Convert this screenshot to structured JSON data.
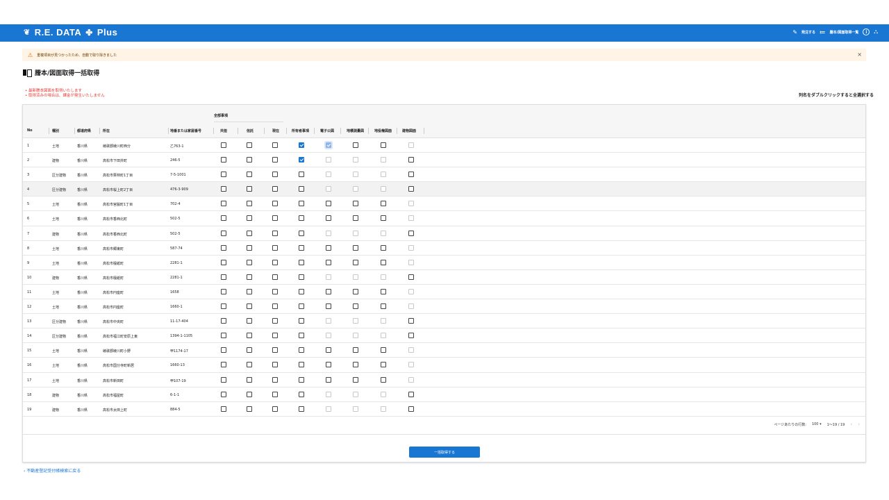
{
  "header": {
    "brand": "R.E. DATA",
    "brand_suffix": "Plus",
    "actions": {
      "order_label": "発注する",
      "list_label": "謄本/図面取得一覧"
    },
    "icons": [
      "leaf-logo-icon",
      "handshake-logo-icon",
      "pencil-icon",
      "list-icon",
      "info-icon",
      "account-tree-icon"
    ],
    "accent_color": "#1976d2"
  },
  "alert": {
    "message": "重複項目が見つかったため、自動で取り除きました",
    "close": "×"
  },
  "page": {
    "title": "謄本/図面取得一括取得",
    "notes": [
      "最新謄本図面を取得いたします",
      "取得済みの場合は、課金が発生いたしません"
    ],
    "hint": "列名をダブルクリックすると全選択する"
  },
  "table": {
    "group_header": "全部事項",
    "columns": [
      "No",
      "種別",
      "都道府県",
      "所在",
      "地番または家屋番号",
      "共担",
      "信託",
      "現在",
      "所有者事項",
      "電子公図",
      "地積測量図",
      "地役権図面",
      "建物図面"
    ],
    "rows": [
      {
        "no": "1",
        "type": "土地",
        "pref": "香川県",
        "loc": "綾歌郡綾川町西分",
        "num": "乙763-1",
        "checks": [
          "off",
          "off",
          "off",
          "on",
          "ondis",
          "off",
          "off",
          "dis"
        ]
      },
      {
        "no": "2",
        "type": "建物",
        "pref": "香川県",
        "loc": "高松市下田井町",
        "num": "246-5",
        "checks": [
          "off",
          "off",
          "off",
          "on",
          "dis",
          "dis",
          "dis",
          "off"
        ]
      },
      {
        "no": "3",
        "type": "区分建物",
        "pref": "香川県",
        "loc": "高松市栗林町1丁目",
        "num": "7-5-1001",
        "checks": [
          "off",
          "off",
          "off",
          "off",
          "dis",
          "dis",
          "dis",
          "off"
        ]
      },
      {
        "no": "4",
        "type": "区分建物",
        "pref": "香川県",
        "loc": "高松市桜上町2丁目",
        "num": "476-3-909",
        "checks": [
          "off",
          "off",
          "off",
          "off",
          "dis",
          "dis",
          "dis",
          "off"
        ]
      },
      {
        "no": "5",
        "type": "土地",
        "pref": "香川県",
        "loc": "高松市宮脇町1丁目",
        "num": "702-4",
        "checks": [
          "off",
          "off",
          "off",
          "off",
          "off",
          "off",
          "off",
          "dis"
        ]
      },
      {
        "no": "6",
        "type": "土地",
        "pref": "香川県",
        "loc": "高松市香西北町",
        "num": "502-5",
        "checks": [
          "off",
          "off",
          "off",
          "off",
          "off",
          "off",
          "off",
          "dis"
        ]
      },
      {
        "no": "7",
        "type": "建物",
        "pref": "香川県",
        "loc": "高松市香西北町",
        "num": "502-5",
        "checks": [
          "off",
          "off",
          "off",
          "off",
          "dis",
          "dis",
          "dis",
          "off"
        ]
      },
      {
        "no": "8",
        "type": "土地",
        "pref": "香川県",
        "loc": "高松市郷東町",
        "num": "587-74",
        "checks": [
          "off",
          "off",
          "off",
          "off",
          "off",
          "off",
          "off",
          "dis"
        ]
      },
      {
        "no": "9",
        "type": "土地",
        "pref": "香川県",
        "loc": "高松市檀紙町",
        "num": "2281-1",
        "checks": [
          "off",
          "off",
          "off",
          "off",
          "off",
          "off",
          "off",
          "dis"
        ]
      },
      {
        "no": "10",
        "type": "建物",
        "pref": "香川県",
        "loc": "高松市檀紙町",
        "num": "2281-1",
        "checks": [
          "off",
          "off",
          "off",
          "off",
          "dis",
          "dis",
          "dis",
          "off"
        ]
      },
      {
        "no": "11",
        "type": "土地",
        "pref": "香川県",
        "loc": "高松市円座町",
        "num": "1658",
        "checks": [
          "off",
          "off",
          "off",
          "off",
          "off",
          "off",
          "off",
          "dis"
        ]
      },
      {
        "no": "12",
        "type": "土地",
        "pref": "香川県",
        "loc": "高松市円座町",
        "num": "1660-1",
        "checks": [
          "off",
          "off",
          "off",
          "off",
          "off",
          "off",
          "off",
          "dis"
        ]
      },
      {
        "no": "13",
        "type": "区分建物",
        "pref": "香川県",
        "loc": "高松市中央町",
        "num": "11-17-404",
        "checks": [
          "off",
          "off",
          "off",
          "off",
          "dis",
          "dis",
          "dis",
          "off"
        ]
      },
      {
        "no": "14",
        "type": "区分建物",
        "pref": "香川県",
        "loc": "高松市福江町安原上東",
        "num": "1394-1-1105",
        "checks": [
          "off",
          "off",
          "off",
          "off",
          "dis",
          "dis",
          "dis",
          "off"
        ]
      },
      {
        "no": "15",
        "type": "土地",
        "pref": "香川県",
        "loc": "綾歌郡綾川町小野",
        "num": "甲1174-17",
        "checks": [
          "off",
          "off",
          "off",
          "off",
          "off",
          "off",
          "off",
          "dis"
        ]
      },
      {
        "no": "16",
        "type": "土地",
        "pref": "香川県",
        "loc": "高松市国分寺町新居",
        "num": "1660-13",
        "checks": [
          "off",
          "off",
          "off",
          "off",
          "off",
          "off",
          "off",
          "dis"
        ]
      },
      {
        "no": "17",
        "type": "土地",
        "pref": "香川県",
        "loc": "高松市新田町",
        "num": "甲107-19",
        "checks": [
          "off",
          "off",
          "off",
          "off",
          "off",
          "off",
          "off",
          "dis"
        ]
      },
      {
        "no": "18",
        "type": "建物",
        "pref": "香川県",
        "loc": "高松市福屋町",
        "num": "6-1-1",
        "checks": [
          "off",
          "off",
          "off",
          "off",
          "dis",
          "dis",
          "dis",
          "off"
        ]
      },
      {
        "no": "19",
        "type": "建物",
        "pref": "香川県",
        "loc": "高松市太田上町",
        "num": "884-5",
        "checks": [
          "off",
          "off",
          "off",
          "off",
          "dis",
          "dis",
          "dis",
          "off"
        ]
      }
    ]
  },
  "pagination": {
    "rows_per_page_label": "ページあたりの行数:",
    "rows_per_page": "100",
    "range": "1～19 / 19",
    "prev": "‹",
    "next": "›"
  },
  "bulk_button": "一括取得する",
  "back_link": "‹ 不動産登記受付帳検索に戻る"
}
